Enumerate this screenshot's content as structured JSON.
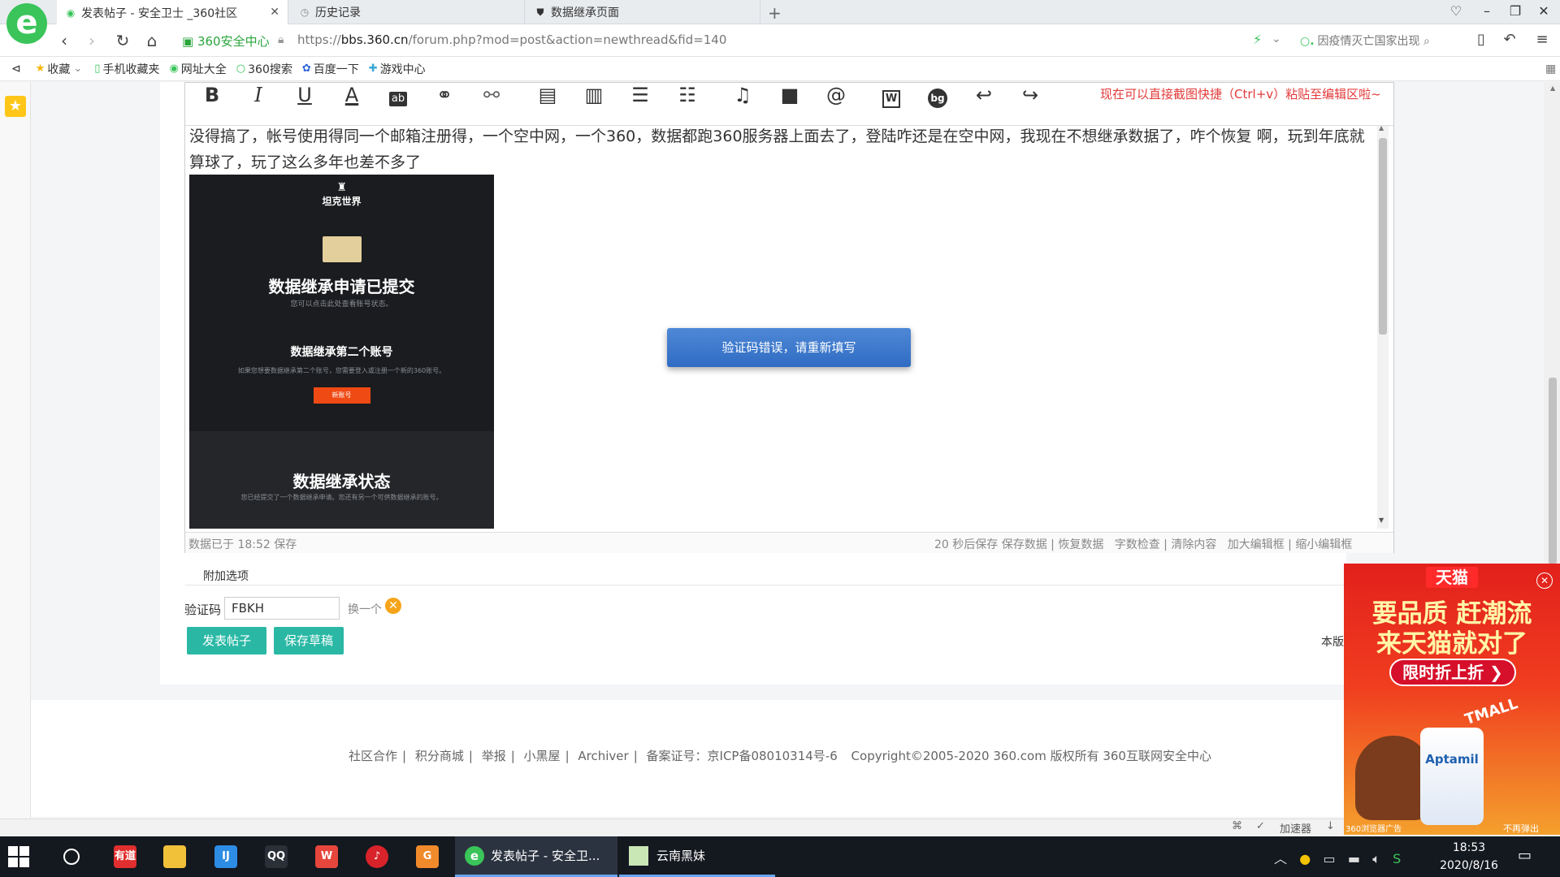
{
  "browser": {
    "logo_letter": "e",
    "tabs": [
      {
        "title": "发表帖子 - 安全卫士 _360社区",
        "active": true
      },
      {
        "title": "历史记录",
        "active": false
      },
      {
        "title": "数据继承页面",
        "active": false
      }
    ],
    "new_tab": "+",
    "security_label": "360安全中心",
    "url_prefix": "https://",
    "url_host": "bbs.360.cn",
    "url_path": "/forum.php?mod=post&action=newthread&fid=140",
    "search_placeholder": "因疫情灭亡国家出现"
  },
  "bookmarks": [
    {
      "icon": "star-icon",
      "label": "收藏"
    },
    {
      "icon": "phone-icon",
      "label": "手机收藏夹"
    },
    {
      "icon": "globe-icon",
      "label": "网址大全"
    },
    {
      "icon": "search-icon",
      "label": "360搜索"
    },
    {
      "icon": "paw-icon",
      "label": "百度一下"
    },
    {
      "icon": "gamepad-icon",
      "label": "游戏中心"
    }
  ],
  "editor": {
    "paste_tip": "现在可以直接截图快捷（Ctrl+v）粘贴至编辑区啦~",
    "toolbar_icons": [
      "bold-icon",
      "italic-icon",
      "underline-icon",
      "font-color-icon",
      "background-color-icon",
      "link-icon",
      "unlink-icon",
      "quote-icon",
      "code-icon",
      "ordered-list-icon",
      "unordered-list-icon",
      "music-icon",
      "video-icon",
      "at-icon",
      "word-icon",
      "bg-icon",
      "undo-icon",
      "redo-icon"
    ],
    "post_text": "没得搞了，帐号使用得同一个邮箱注册得，一个空中网，一个360，数据都跑360服务器上面去了，登陆咋还是在空中网，我现在不想继承数据了，咋个恢复 啊，玩到年底就算球了，玩了这么多年也差不多了",
    "screenshot": {
      "logo_text": "坦克世界",
      "title1": "数据继承申请已提交",
      "sub1": "您可以点击此处查看账号状态。",
      "title2": "数据继承第二个账号",
      "sub2": "如果您想要数据继承第二个账号，您需要登入或注册一个新的360账号。",
      "button": "新账号",
      "title3": "数据继承状态",
      "sub3": "您已经提交了一个数据继承申请。您还有另一个可供数据继承的账号。"
    },
    "modal_message": "验证码错误，请重新填写",
    "saved_status": "数据已于 18:52 保存",
    "status_links": [
      "20 秒后保存",
      "保存数据",
      "恢复数据",
      "字数检查",
      "清除内容",
      "加大编辑框",
      "缩小编辑框"
    ]
  },
  "form": {
    "attach_label": "附加选项",
    "captcha_label": "验证码",
    "captcha_value": "FBKH",
    "refresh_label": "换一个",
    "post_button": "发表帖子",
    "draft_button": "保存草稿",
    "rule_note": "本版"
  },
  "footer": {
    "links": [
      "社区合作",
      "积分商城",
      "举报",
      "小黑屋",
      "Archiver"
    ],
    "icp": "备案证号：京ICP备08010314号-6",
    "copyright": "Copyright©2005-2020 360.com 版权所有 360互联网安全中心"
  },
  "ad": {
    "brand": "天猫",
    "line1": "要品质 赶潮流",
    "line2": "来天猫就对了",
    "cta": "限时折上折",
    "tmall": "TMALL",
    "product": "Aptamil",
    "source": "360浏览器广告",
    "dismiss": "不再弹出"
  },
  "browser_status": {
    "accelerator": "加速器"
  },
  "taskbar": {
    "apps": [
      {
        "name": "youdao-app",
        "label": "有道",
        "color": "#e12e2e"
      },
      {
        "name": "file-explorer-app",
        "label": "",
        "color": "#f2c13a"
      },
      {
        "name": "jetbrains-app",
        "label": "IJ",
        "color": "#2d8ce3"
      },
      {
        "name": "qq-app",
        "label": "QQ",
        "color": "#14181f"
      },
      {
        "name": "wps-app",
        "label": "W",
        "color": "#e6463c"
      },
      {
        "name": "netease-music-app",
        "label": "♪",
        "color": "#d8232a"
      },
      {
        "name": "game-app",
        "label": "G",
        "color": "#f08a2b"
      }
    ],
    "windows": [
      {
        "title": "发表帖子 - 安全卫...",
        "active": true
      },
      {
        "title": "云南黑妹",
        "active": false
      }
    ],
    "time": "18:53",
    "date": "2020/8/16"
  }
}
